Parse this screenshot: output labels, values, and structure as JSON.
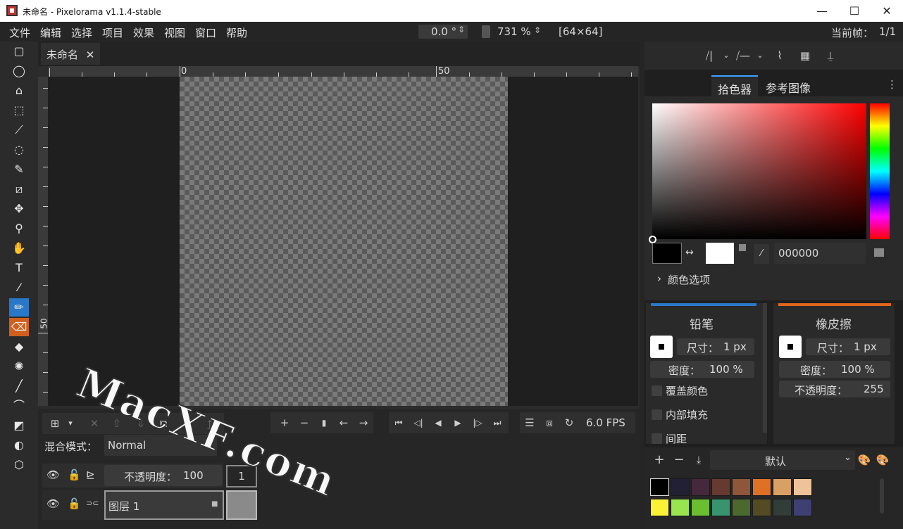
{
  "window": {
    "title": "未命名 - Pixelorama v1.1.4-stable",
    "minimize": "—",
    "maximize": "☐",
    "close": "✕"
  },
  "menu": {
    "items": [
      "文件",
      "编辑",
      "选择",
      "项目",
      "效果",
      "视图",
      "窗口",
      "帮助"
    ],
    "rotation": "0.0 °",
    "zoom": "731 %",
    "canvas_size": "[64×64]",
    "current_frame_label": "当前帧：",
    "current_frame_value": "1/1"
  },
  "tabs": {
    "file": "未命名",
    "close": "✕"
  },
  "ruler": {
    "top_0": "0",
    "top_50": "50",
    "left_50": "50"
  },
  "tools": [
    "rect-select",
    "ellipse-select",
    "polygon-select",
    "color-select",
    "magic-wand",
    "lasso",
    "paint-select",
    "crop",
    "move",
    "zoom",
    "pan",
    "text",
    "color-picker",
    "pencil",
    "eraser",
    "bucket",
    "shading",
    "line",
    "curve",
    "rectangle",
    "ellipse",
    "3d-shape"
  ],
  "timeline": {
    "fps": "6.0 FPS",
    "blend_label": "混合模式：",
    "blend_value": "Normal",
    "opacity_label": "不透明度：",
    "opacity_value": "100",
    "frame_number": "1",
    "layer_name": "图层 1"
  },
  "right": {
    "tab_picker": "拾色器",
    "tab_reference": "参考图像",
    "hex_value": "000000",
    "color_options": "颜色选项",
    "primary_color": "#000000",
    "secondary_color": "#ffffff"
  },
  "left_tool": {
    "name": "铅笔",
    "size_label": "尺寸：",
    "size_value": "1 px",
    "density_label": "密度：",
    "density_value": "100 %",
    "overwrite": "覆盖颜色",
    "fill_inside": "内部填充",
    "spacing": "间距",
    "accent": "#2a78c8"
  },
  "right_tool": {
    "name": "橡皮擦",
    "size_label": "尺寸：",
    "size_value": "1 px",
    "density_label": "密度：",
    "density_value": "100 %",
    "opacity_label": "不透明度：",
    "opacity_value": "255",
    "accent": "#e0661e"
  },
  "palette": {
    "name": "默认",
    "colors": [
      "#000000",
      "#222034",
      "#45283c",
      "#663931",
      "#8f563b",
      "#df7126",
      "#d9a066",
      "#eec39a",
      "#fbf236",
      "#99e550",
      "#6abe30",
      "#37946e",
      "#4b692f",
      "#524b24",
      "#323c39",
      "#3f3f74"
    ]
  },
  "watermark": "MacXF.com"
}
